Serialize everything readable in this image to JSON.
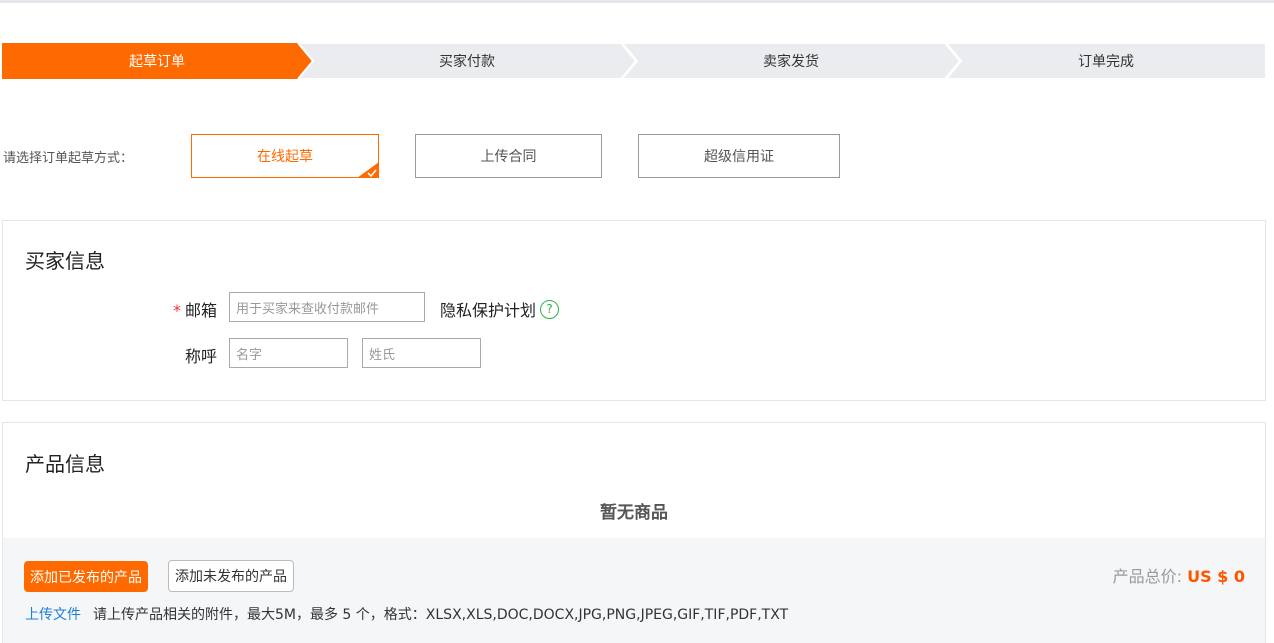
{
  "stepper": {
    "steps": [
      {
        "label": "起草订单",
        "active": true
      },
      {
        "label": "买家付款",
        "active": false
      },
      {
        "label": "卖家发货",
        "active": false
      },
      {
        "label": "订单完成",
        "active": false
      }
    ],
    "active_color": "#ff6a00",
    "inactive_color": "#ebecf0"
  },
  "method": {
    "label": "请选择订单起草方式：",
    "options": [
      "在线起草",
      "上传合同",
      "超级信用证"
    ],
    "selected": "在线起草"
  },
  "buyer": {
    "title": "买家信息",
    "email_label": "邮箱",
    "required_mark": "*",
    "email_placeholder": "用于买家来查收付款邮件",
    "privacy_label": "隐私保护计划",
    "help_icon": "?",
    "name_label": "称呼",
    "first_name_placeholder": "名字",
    "last_name_placeholder": "姓氏"
  },
  "product": {
    "title": "产品信息",
    "empty_text": "暂无商品",
    "add_published": "添加已发布的产品",
    "add_unpublished": "添加未发布的产品",
    "total_label": "产品总价:",
    "total_value": "US $ 0",
    "upload_link": "上传文件",
    "upload_hint": "请上传产品相关的附件，最大5M，最多 5 个，格式：XLSX,XLS,DOC,DOCX,JPG,PNG,JPEG,GIF,TIF,PDF,TXT"
  }
}
